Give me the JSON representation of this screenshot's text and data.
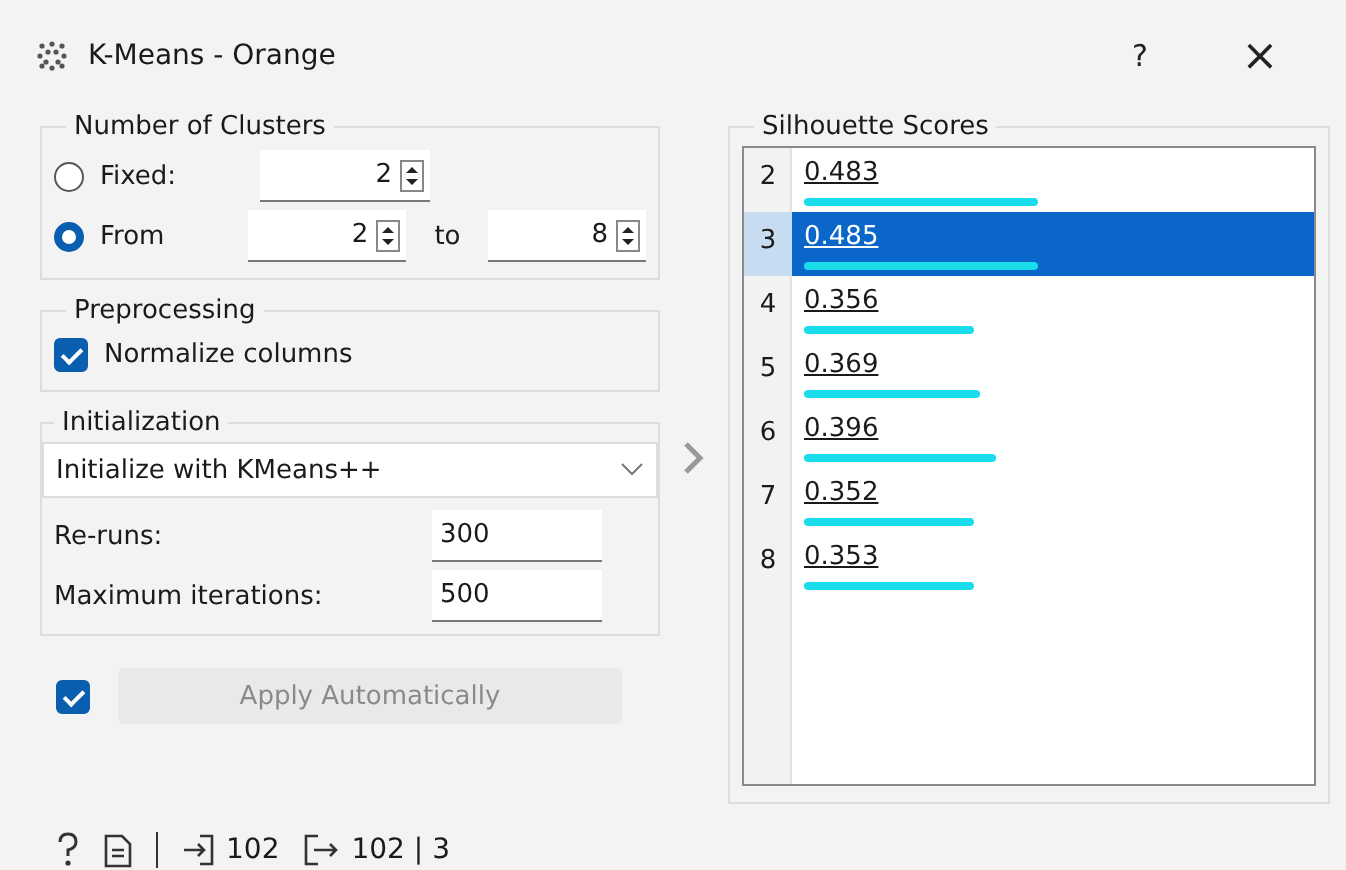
{
  "window": {
    "title": "K-Means - Orange",
    "help": "?",
    "close": "×"
  },
  "clusters": {
    "title": "Number of Clusters",
    "options": [
      {
        "label": "Fixed:",
        "selected": false,
        "from": "2"
      },
      {
        "label": "From",
        "selected": true,
        "from": "2",
        "joiner": "to",
        "to": "8"
      }
    ]
  },
  "preprocessing": {
    "title": "Preprocessing",
    "normalize": {
      "label": "Normalize columns",
      "checked": true
    }
  },
  "initialization": {
    "title": "Initialization",
    "method": "Initialize with KMeans++",
    "reruns": {
      "label": "Re-runs:",
      "value": "300"
    },
    "max_iterations": {
      "label": "Maximum iterations:",
      "value": "500"
    }
  },
  "apply": {
    "checked": true,
    "label": "Apply Automatically"
  },
  "scores": {
    "title": "Silhouette Scores",
    "rows": [
      {
        "k": "2",
        "score": "0.483",
        "level": 0.47,
        "selected": false
      },
      {
        "k": "3",
        "score": "0.485",
        "level": 0.47,
        "selected": true
      },
      {
        "k": "4",
        "score": "0.356",
        "level": 0.34,
        "selected": false
      },
      {
        "k": "5",
        "score": "0.369",
        "level": 0.355,
        "selected": false
      },
      {
        "k": "6",
        "score": "0.396",
        "level": 0.385,
        "selected": false
      },
      {
        "k": "7",
        "score": "0.352",
        "level": 0.34,
        "selected": false
      },
      {
        "k": "8",
        "score": "0.353",
        "level": 0.34,
        "selected": false
      }
    ]
  },
  "status_bar": {
    "input_count": "102",
    "output_count": "102 | 3"
  }
}
